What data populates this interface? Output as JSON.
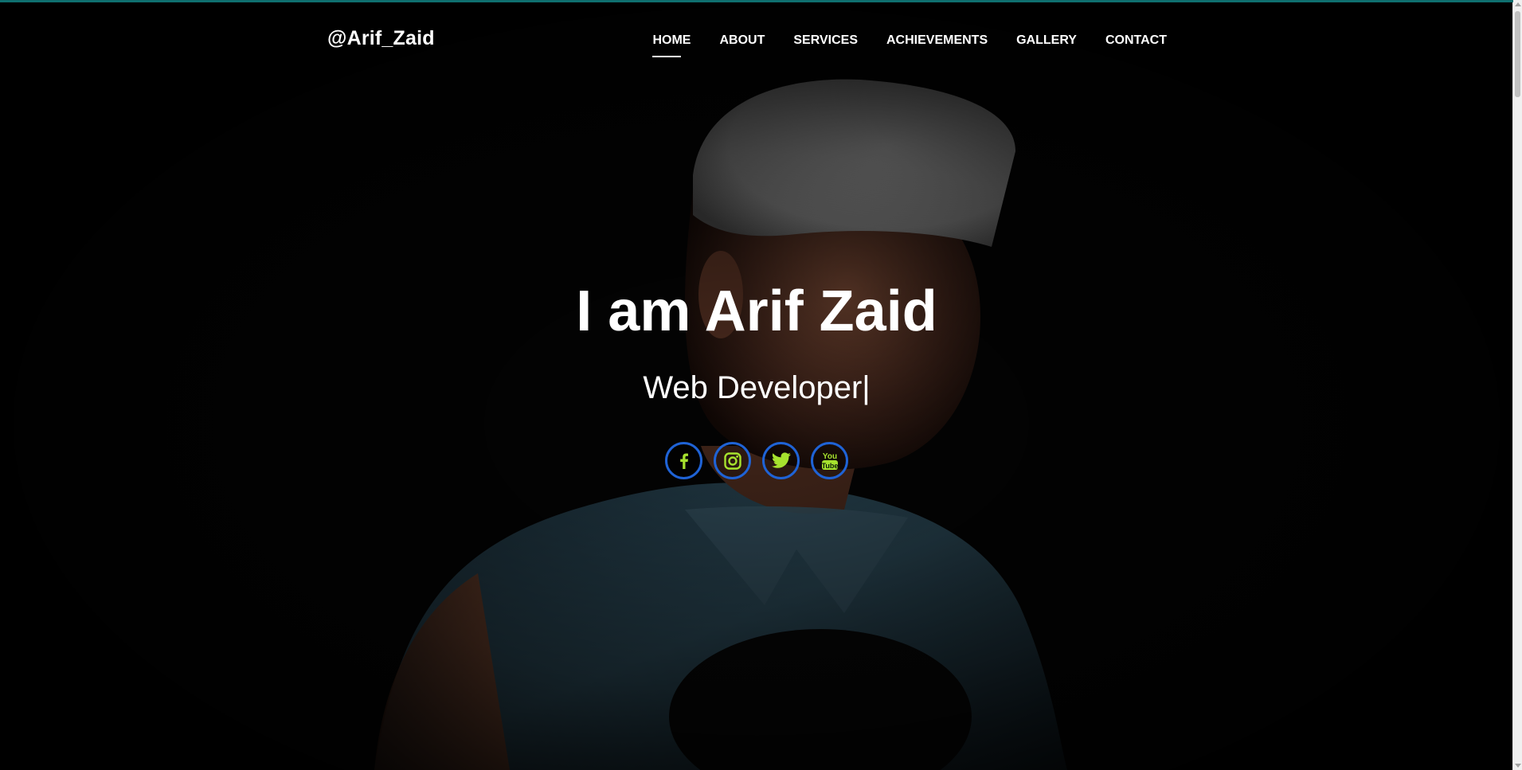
{
  "header": {
    "brand": "@Arif_Zaid",
    "nav": [
      {
        "label": "HOME",
        "active": true
      },
      {
        "label": "ABOUT",
        "active": false
      },
      {
        "label": "SERVICES",
        "active": false
      },
      {
        "label": "ACHIEVEMENTS",
        "active": false
      },
      {
        "label": "GALLERY",
        "active": false
      },
      {
        "label": "CONTACT",
        "active": false
      }
    ]
  },
  "hero": {
    "title": "I am Arif Zaid",
    "subtitle": "Web Developer",
    "cursor": "|",
    "socials": [
      {
        "icon": "facebook-icon"
      },
      {
        "icon": "instagram-icon"
      },
      {
        "icon": "twitter-icon"
      },
      {
        "icon": "youtube-icon"
      }
    ]
  },
  "colors": {
    "accent_icon": "#a6e22e",
    "social_border": "#1f63d6",
    "top_line": "#0f6f6f",
    "text": "#ffffff"
  }
}
